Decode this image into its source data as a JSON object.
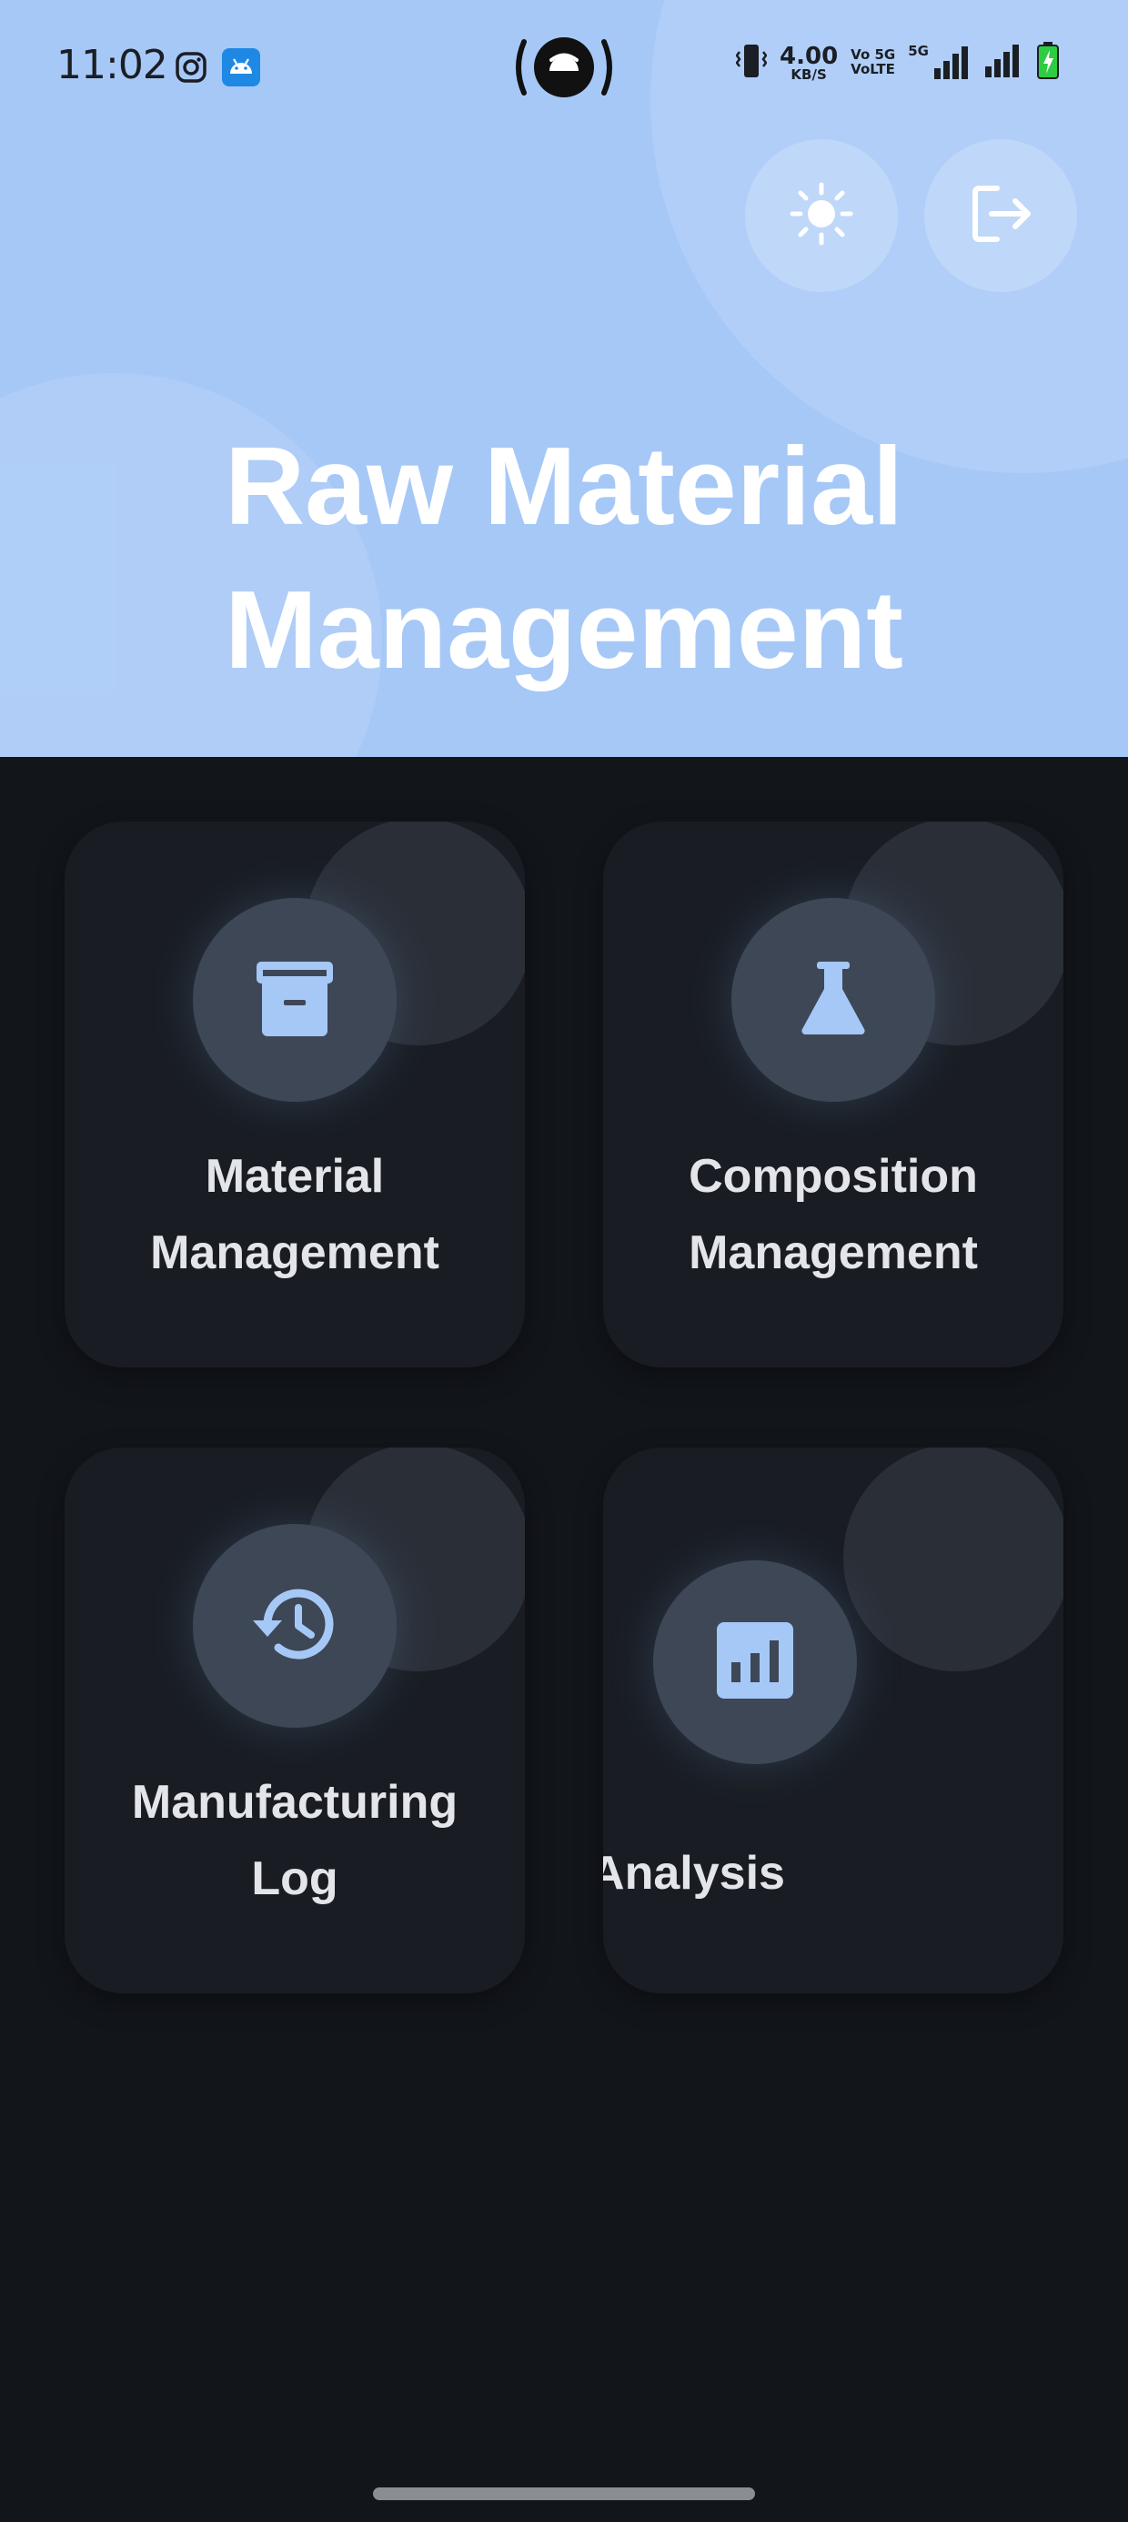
{
  "status_bar": {
    "time": "11:02",
    "net_speed_value": "4.00",
    "net_speed_unit": "KB/S",
    "volte_line1": "Vo 5G",
    "volte_line2": "VoLTE",
    "network_type": "5G",
    "icons": [
      "instagram-icon",
      "android-icon",
      "hotspot-icon",
      "vibrate-icon",
      "signal-icon",
      "battery-icon"
    ]
  },
  "header": {
    "title_line1": "Raw Material",
    "title_line2": "Management",
    "background_color": "#a6c8f7",
    "buttons": [
      "theme-toggle",
      "logout"
    ]
  },
  "menu": {
    "cards": [
      {
        "label_line1": "Material",
        "label_line2": "Management",
        "icon": "archive-icon"
      },
      {
        "label_line1": "Composition",
        "label_line2": "Management",
        "icon": "flask-icon"
      },
      {
        "label_line1": "Manufacturing",
        "label_line2": "Log",
        "icon": "history-icon"
      },
      {
        "label_line1": "Analysis",
        "icon": "analytics-icon"
      }
    ],
    "accent_color": "#a6c8f7",
    "card_color": "#191d23",
    "background_color": "#12151a"
  }
}
